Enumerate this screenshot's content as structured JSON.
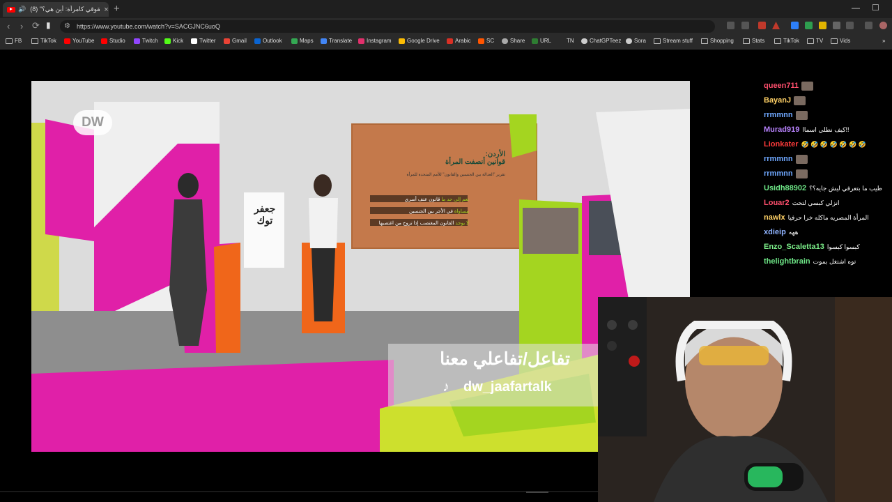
{
  "browser": {
    "tab_title": "(8) \"حقوقي كامرأة: أين هي؟\" |",
    "close_glyph": "×",
    "new_tab_glyph": "+",
    "url": "https://www.youtube.com/watch?v=SACGJNC6uoQ"
  },
  "bookmarks": [
    {
      "label": "FB",
      "icon": "folder-icon",
      "color": ""
    },
    {
      "label": "TikTok",
      "icon": "folder-icon",
      "color": ""
    },
    {
      "label": "YouTube",
      "icon": "youtube-icon",
      "color": "#ff0000"
    },
    {
      "label": "Studio",
      "icon": "studio-icon",
      "color": "#ff0000"
    },
    {
      "label": "Twitch",
      "icon": "twitch-icon",
      "color": "#9146ff"
    },
    {
      "label": "Kick",
      "icon": "kick-icon",
      "color": "#53fc18"
    },
    {
      "label": "Twitter",
      "icon": "x-icon",
      "color": "#ffffff"
    },
    {
      "label": "Gmail",
      "icon": "gmail-icon",
      "color": "#ea4335"
    },
    {
      "label": "Outlook",
      "icon": "outlook-icon",
      "color": "#0a64d1"
    },
    {
      "label": "Maps",
      "icon": "maps-icon",
      "color": "#34a853"
    },
    {
      "label": "Translate",
      "icon": "translate-icon",
      "color": "#4285f4"
    },
    {
      "label": "Instagram",
      "icon": "instagram-icon",
      "color": "#e1306c"
    },
    {
      "label": "Google Drive",
      "icon": "drive-icon",
      "color": "#fbbc04"
    },
    {
      "label": "Arabic",
      "icon": "arabic-icon",
      "color": "#d93025"
    },
    {
      "label": "SC",
      "icon": "sc-icon",
      "color": "#ff5500"
    },
    {
      "label": "Share",
      "icon": "cloud-icon",
      "color": "#aaaaaa"
    },
    {
      "label": "URL",
      "icon": "url-icon",
      "color": "#2e7d32"
    },
    {
      "label": "TN",
      "icon": "",
      "color": ""
    },
    {
      "label": "ChatGPTeez",
      "icon": "chatgpt-icon",
      "color": "#cccccc"
    },
    {
      "label": "Sora",
      "icon": "sora-icon",
      "color": "#cccccc"
    },
    {
      "label": "Stream stuff",
      "icon": "folder-icon",
      "color": ""
    },
    {
      "label": "Shopping",
      "icon": "folder-icon",
      "color": ""
    },
    {
      "label": "Stats",
      "icon": "folder-icon",
      "color": ""
    },
    {
      "label": "TikTok",
      "icon": "folder-icon",
      "color": ""
    },
    {
      "label": "TV",
      "icon": "folder-icon",
      "color": ""
    },
    {
      "label": "Vids",
      "icon": "folder-icon",
      "color": ""
    }
  ],
  "video": {
    "logo": "DW",
    "screen_title_line1": "الأردن:",
    "screen_title_line2": "قوانين أنصفت المرأة",
    "screen_subtitle": "تقرير \"العدالة بين الجنسين والقانون\" للأمم المتحدة للمرأة",
    "screen_rows": [
      {
        "tag": "نعم إلى حد ما",
        "text": "قانون عنف أسري"
      },
      {
        "tag": "مساواة",
        "text": "في الأجر بين الجنسين"
      },
      {
        "tag": "لا يوجد",
        "text": "القانون المغتصب إذا تزوج من اغتصبها"
      }
    ],
    "cta_title": "تفاعل/تفاعلي معنا",
    "cta_handle": "dw_jaafartalk",
    "set_brand": "جعفر توك"
  },
  "chat": [
    {
      "user": "queen711",
      "text": "",
      "color": "#ff4f6d",
      "avatar": true
    },
    {
      "user": "BayanJ",
      "text": "",
      "color": "#ffd166",
      "avatar": true
    },
    {
      "user": "rrmmnn",
      "text": "",
      "color": "#6fa8ff",
      "avatar": true
    },
    {
      "user": "Murad919",
      "text": "كيف نطلي اسماا!!",
      "color": "#b983ff",
      "avatar": false
    },
    {
      "user": "Lionkater",
      "text": "🤣 🤣 🤣 🤣 🤣 🤣 🤣",
      "color": "#ff3b3b",
      "avatar": false
    },
    {
      "user": "rrmmnn",
      "text": "",
      "color": "#6fa8ff",
      "avatar": true
    },
    {
      "user": "rrmmnn",
      "text": "",
      "color": "#6fa8ff",
      "avatar": true
    },
    {
      "user": "Usidh88902",
      "text": "طيب ما بتعرفي ليش جايه؟؟",
      "color": "#6ee787",
      "avatar": false
    },
    {
      "user": "Louar2",
      "text": "انزلي كبسي لتحت",
      "color": "#ff4f6d",
      "avatar": false
    },
    {
      "user": "nawlx",
      "text": "المرأة المصريه ماكله خرا حرفيا",
      "color": "#ffd166",
      "avatar": false
    },
    {
      "user": "xdieip",
      "text": "ههه",
      "color": "#8fb3ff",
      "avatar": false
    },
    {
      "user": "Enzo_Scaletta13",
      "text": "كبسوا كبسوا",
      "color": "#7cf08a",
      "avatar": false
    },
    {
      "user": "thelightbrain",
      "text": "توه اشتغل بموت",
      "color": "#6ee787",
      "avatar": false
    }
  ]
}
